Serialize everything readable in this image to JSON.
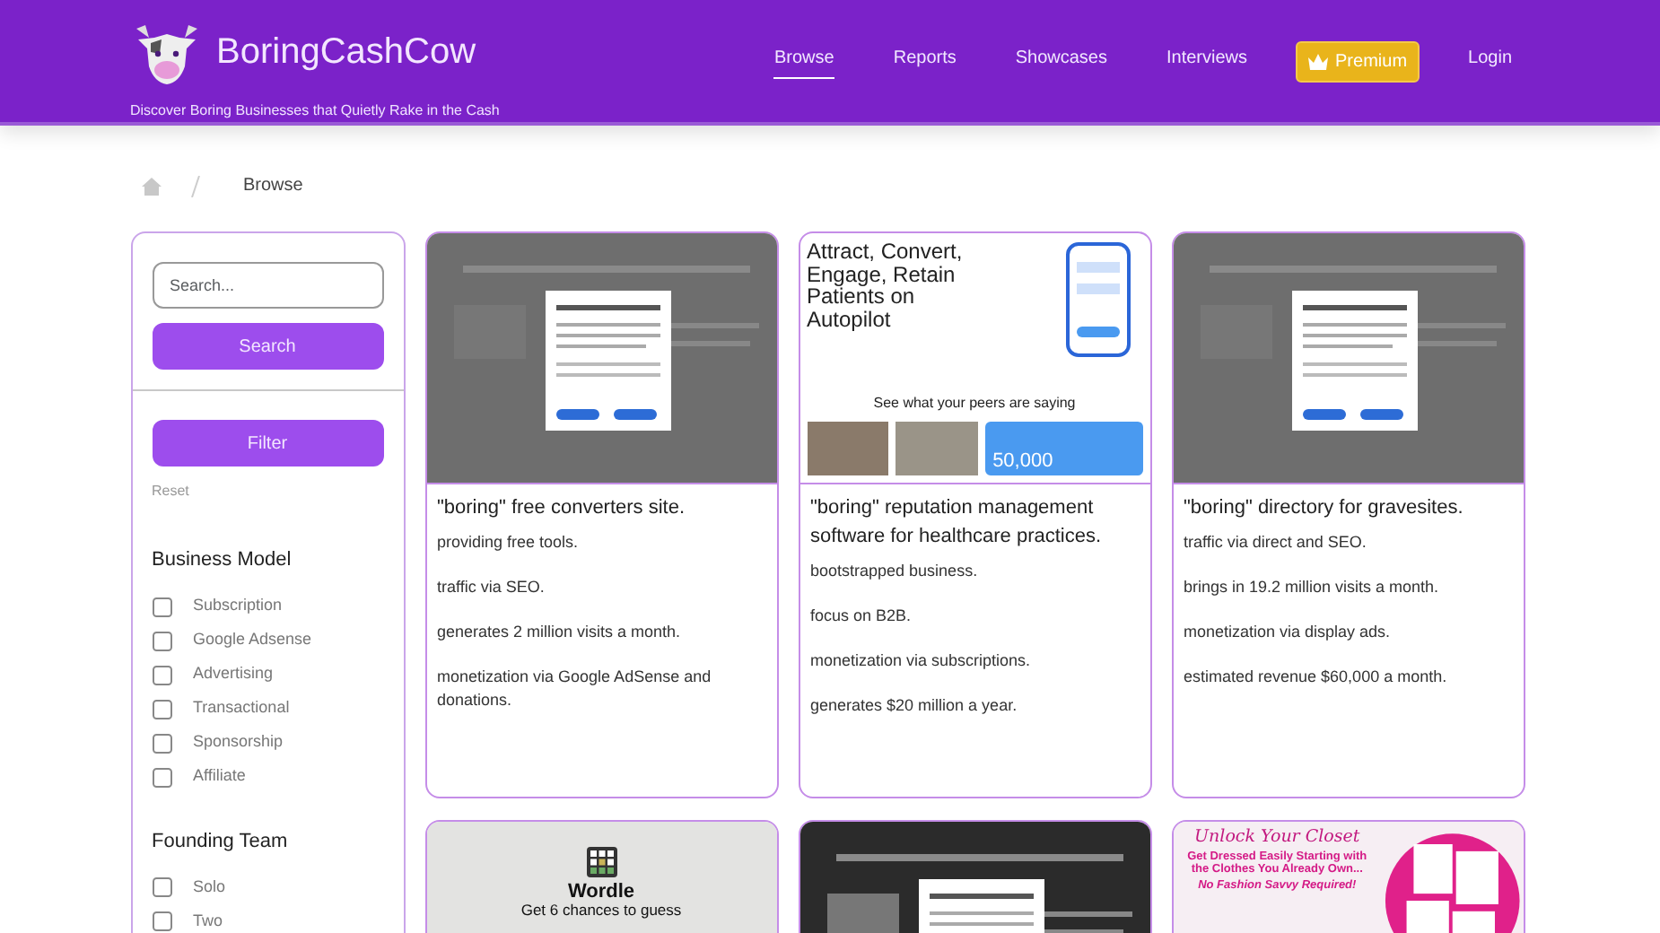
{
  "header": {
    "brand": "BoringCashCow",
    "tagline": "Discover Boring Businesses that Quietly Rake in the Cash",
    "nav": [
      {
        "label": "Browse",
        "kind": "link",
        "selected": true
      },
      {
        "label": "Reports",
        "kind": "link",
        "selected": false
      },
      {
        "label": "Showcases",
        "kind": "link",
        "selected": false
      },
      {
        "label": "Interviews",
        "kind": "link",
        "selected": false
      },
      {
        "label": "Premium",
        "kind": "premium"
      },
      {
        "label": "Login",
        "kind": "link",
        "selected": false
      }
    ]
  },
  "breadcrumb": {
    "current": "Browse"
  },
  "sidebar": {
    "search": {
      "placeholder": "Search..."
    },
    "search_button": "Search",
    "filter_button": "Filter",
    "reset": "Reset",
    "groups": [
      {
        "title": "Business Model",
        "options": [
          {
            "label": "Subscription",
            "checked": false
          },
          {
            "label": "Google Adsense",
            "checked": false
          },
          {
            "label": "Advertising",
            "checked": false
          },
          {
            "label": "Transactional",
            "checked": false
          },
          {
            "label": "Sponsorship",
            "checked": false
          },
          {
            "label": "Affiliate",
            "checked": false
          }
        ]
      },
      {
        "title": "Founding Team",
        "options": [
          {
            "label": "Solo",
            "checked": false
          },
          {
            "label": "Two",
            "checked": false
          }
        ]
      }
    ]
  },
  "cards": [
    {
      "thumbnail": {
        "kind": "dimmed-page"
      },
      "title": "\"boring\" free converters site.",
      "lines": [
        "providing free tools.",
        "traffic via SEO.",
        "generates 2 million visits a month.",
        "monetization via Google AdSense and donations."
      ]
    },
    {
      "thumbnail": {
        "kind": "landing",
        "headline": "Attract, Convert, Engage, Retain Patients on Autopilot",
        "subhead": "See what your peers are saying",
        "stat": "50,000"
      },
      "title": "\"boring\" reputation management software for healthcare practices.",
      "lines": [
        "bootstrapped business.",
        "focus on B2B.",
        "monetization via subscriptions.",
        "generates $20 million a year."
      ]
    },
    {
      "thumbnail": {
        "kind": "dimmed-page"
      },
      "title": "\"boring\" directory for gravesites.",
      "lines": [
        "traffic via direct and SEO.",
        "brings in 19.2 million visits a month.",
        "monetization via display ads.",
        "estimated revenue $60,000 a month."
      ]
    },
    {
      "thumbnail": {
        "kind": "wordle",
        "headline": "Wordle",
        "subhead": "Get 6 chances to guess"
      }
    },
    {
      "thumbnail": {
        "kind": "dark-page"
      }
    },
    {
      "thumbnail": {
        "kind": "closet-ad",
        "headline": "Unlock Your Closet",
        "subhead": "Get Dressed Easily Starting with the Clothes You Already Own...",
        "stat": "No Fashion Savvy Required!"
      }
    }
  ]
}
